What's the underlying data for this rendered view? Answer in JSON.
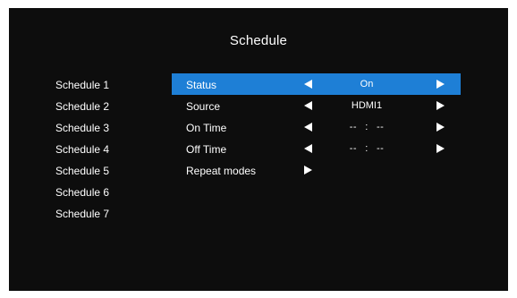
{
  "screen": {
    "title": "Schedule"
  },
  "schedules": [
    {
      "label": "Schedule 1"
    },
    {
      "label": "Schedule 2"
    },
    {
      "label": "Schedule 3"
    },
    {
      "label": "Schedule 4"
    },
    {
      "label": "Schedule 5"
    },
    {
      "label": "Schedule 6"
    },
    {
      "label": "Schedule 7"
    }
  ],
  "settings": {
    "status": {
      "label": "Status",
      "value": "On",
      "selected": true
    },
    "source": {
      "label": "Source",
      "value": "HDMI1"
    },
    "on_time": {
      "label": "On Time",
      "hour": "--",
      "separator": ":",
      "minute": "--"
    },
    "off_time": {
      "label": "Off Time",
      "hour": "--",
      "separator": ":",
      "minute": "--"
    },
    "repeat_modes": {
      "label": "Repeat modes"
    }
  },
  "icons": {
    "left_arrow": "arrow-left-icon",
    "right_arrow": "arrow-right-icon"
  },
  "colors": {
    "background": "#0d0d0d",
    "highlight": "#1e7fd6",
    "text": "#ffffff"
  }
}
